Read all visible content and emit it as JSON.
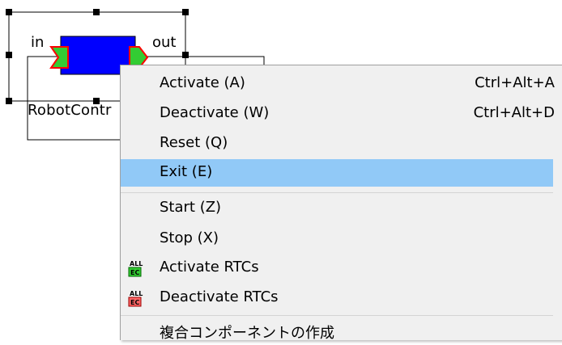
{
  "component": {
    "name": "RobotContr",
    "in_port": "in",
    "out_port": "out"
  },
  "context_menu": {
    "items": [
      {
        "label": "Activate (A)",
        "shortcut": "Ctrl+Alt+A"
      },
      {
        "label": "Deactivate (W)",
        "shortcut": "Ctrl+Alt+D"
      },
      {
        "label": "Reset (Q)",
        "shortcut": ""
      },
      {
        "label": "Exit (E)",
        "shortcut": "",
        "highlighted": true
      },
      {
        "label": "Start (Z)",
        "shortcut": ""
      },
      {
        "label": "Stop (X)",
        "shortcut": ""
      },
      {
        "label": "Activate RTCs",
        "icon": "all-ec-green-icon"
      },
      {
        "label": "Deactivate RTCs",
        "icon": "all-ec-red-icon"
      },
      {
        "label": "複合コンポーネントの作成"
      }
    ]
  },
  "colors": {
    "component_body": "#0000ff",
    "port_fill": "#33cc33",
    "port_outline": "#ff0000",
    "menu_bg": "#f0f0f0",
    "menu_highlight": "#91c9f7"
  }
}
